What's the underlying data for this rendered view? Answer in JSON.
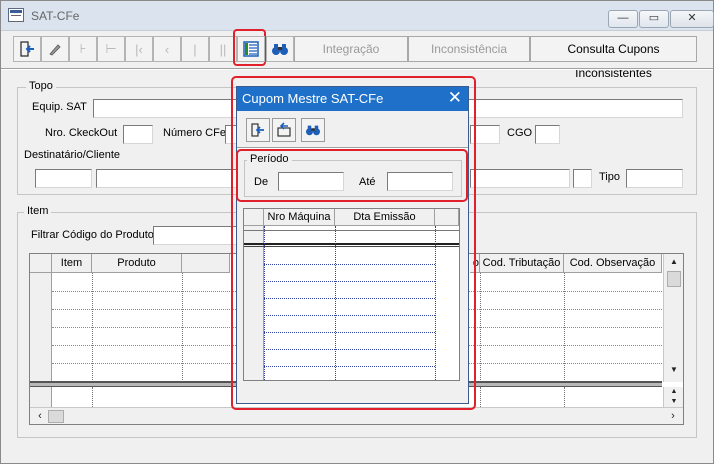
{
  "window": {
    "title": "SAT-CFe",
    "minimize_glyph": "—",
    "maximize_glyph": "▭",
    "close_glyph": "✕"
  },
  "toolbar": {
    "exit_icon": "exit-door-icon",
    "edit_icon": "pencil-icon",
    "integracao_label": "Integração",
    "inconsistencia_label": "Inconsistência",
    "consulta_label": "Consulta Cupons Inconsistentes"
  },
  "topo": {
    "legend": "Topo",
    "equip_sat_label": "Equip. SAT",
    "nro_checkout_label": "Nro. CkeckOut",
    "numero_cfe_label": "Número CFe",
    "cgo_label": "CGO",
    "destinatario_label": "Destinatário/Cliente",
    "tipo_label": "Tipo"
  },
  "item": {
    "legend": "Item",
    "filtrar_label": "Filtrar Código do Produto",
    "columns": [
      "Item",
      "Produto",
      "o",
      "Cod. Tributação",
      "Cod. Observação"
    ]
  },
  "dialog": {
    "title": "Cupom Mestre SAT-CFe",
    "close_glyph": "✕",
    "periodo_legend": "Período",
    "de_label": "De",
    "ate_label": "Até",
    "columns": [
      "Nro Máquina",
      "Dta Emissão"
    ]
  },
  "colors": {
    "highlight": "#e0202a",
    "dialog_title_bg": "#1f70c8"
  }
}
